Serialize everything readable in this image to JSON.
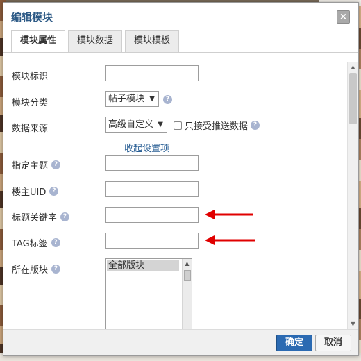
{
  "dialog": {
    "title": "编辑模块",
    "close_glyph": "×",
    "tabs": [
      {
        "label": "模块属性",
        "active": true
      },
      {
        "label": "模块数据",
        "active": false
      },
      {
        "label": "模块模板",
        "active": false
      }
    ]
  },
  "form": {
    "module_id_label": "模块标识",
    "module_id_value": "",
    "category_label": "模块分类",
    "category_value": "帖子模块",
    "source_label": "数据来源",
    "source_value": "高级自定义",
    "push_only_label": "只接受推送数据",
    "push_only_checked": false,
    "collapse_link": "收起设置项",
    "topic_label": "指定主题",
    "topic_value": "",
    "author_uid_label": "楼主UID",
    "author_uid_value": "",
    "title_keyword_label": "标题关键字",
    "title_keyword_value": "",
    "tag_label": "TAG标签",
    "tag_value": "",
    "forum_label": "所在版块",
    "forum_options": [
      "全部版块"
    ],
    "help_glyph": "?"
  },
  "footer": {
    "ok_label": "确定",
    "cancel_label": "取消"
  },
  "colors": {
    "accent": "#2b6ab2",
    "title": "#2d5a86",
    "annotation_arrow": "#e00000"
  }
}
